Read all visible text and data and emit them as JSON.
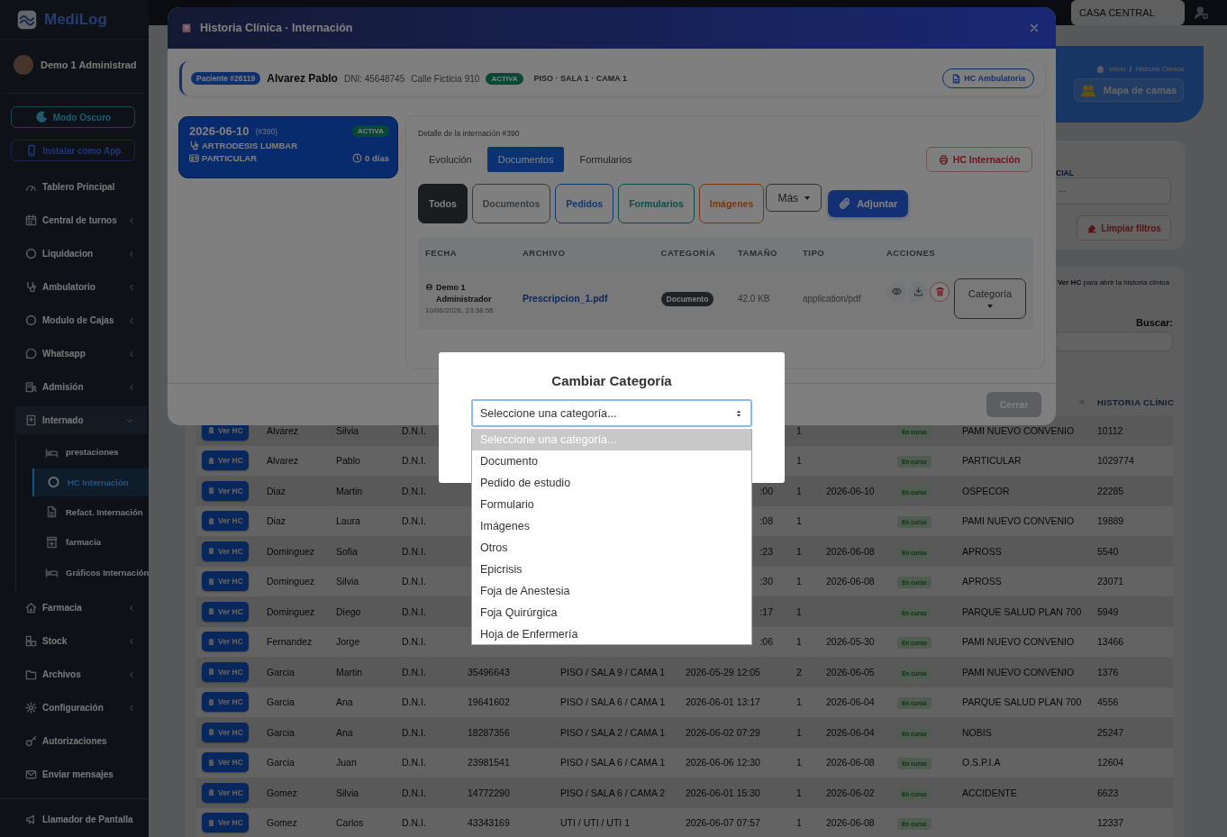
{
  "sidebar": {
    "logo": "MediLog",
    "user": "Demo 1 Administrad",
    "buttons": [
      {
        "label": "Modo Oscuro",
        "kind": "theme"
      },
      {
        "label": "Instalar como App",
        "kind": "install"
      }
    ],
    "items": [
      {
        "label": "Tablero Principal",
        "kind": "link",
        "selected": false
      },
      {
        "label": "Central de turnos",
        "kind": "menu",
        "expanded": false,
        "selected": false
      },
      {
        "label": "Liquidacion",
        "kind": "menu",
        "expanded": false,
        "selected": false
      },
      {
        "label": "Ambulatorio",
        "kind": "menu",
        "expanded": false,
        "selected": false
      },
      {
        "label": "Modulo de Cajas",
        "kind": "menu",
        "expanded": false,
        "selected": false
      },
      {
        "label": "Whatsapp",
        "kind": "menu",
        "expanded": false,
        "selected": false
      },
      {
        "label": "Admisión",
        "kind": "menu",
        "expanded": false,
        "selected": false
      },
      {
        "label": "Internado",
        "kind": "menu",
        "expanded": true,
        "selected": false,
        "children": [
          {
            "label": "prestaciones",
            "selected": false
          },
          {
            "label": "HC Internación",
            "selected": true
          },
          {
            "label": "Refact. Internación",
            "selected": false
          },
          {
            "label": "farmacia",
            "selected": false
          },
          {
            "label": "Gráficos Internación",
            "selected": false
          }
        ]
      },
      {
        "label": "Farmacia",
        "kind": "menu",
        "expanded": false,
        "selected": false
      },
      {
        "label": "Stock",
        "kind": "menu",
        "expanded": false,
        "selected": false
      },
      {
        "label": "Archivos",
        "kind": "menu",
        "expanded": false,
        "selected": false
      },
      {
        "label": "Configuración",
        "kind": "menu",
        "expanded": false,
        "selected": false
      },
      {
        "label": "Autorizaciones",
        "kind": "link",
        "selected": false
      },
      {
        "label": "Enviar mensajes",
        "kind": "link",
        "selected": false
      }
    ],
    "footer_item": "Llamador de Pantalla"
  },
  "topbar": {
    "branch": "CASA CENTRAL"
  },
  "page": {
    "breadcrumb": {
      "items": [
        "Inicio",
        "Historia Clínica"
      ],
      "separator": "/"
    },
    "map_button": "Mapa de camas",
    "filter_label": "CIAL",
    "filter_value": "...",
    "clear_button": "Limpiar filtros",
    "hint": "**Ver HC** para abrir la historia clínica",
    "search_label": "Buscar:",
    "table": {
      "last_column": "HISTORIA CLÍNIC",
      "rows": [
        {
          "button": "Ver HC",
          "surname": "Alvarez",
          "name": "Silvia",
          "doc_type": "D.N.I.",
          "count": "1",
          "status": "En curso",
          "insurer": "PAMI NUEVO CONVENIO",
          "record": "10112"
        },
        {
          "button": "Ver HC",
          "surname": "Alvarez",
          "name": "Pablo",
          "doc_type": "D.N.I.",
          "count": "1",
          "status": "En curso",
          "insurer": "PARTICULAR",
          "record": "1029774"
        },
        {
          "button": "Ver HC",
          "surname": "Diaz",
          "name": "Martin",
          "doc_type": "D.N.I.",
          "admitted_tail": ":00",
          "count": "1",
          "date": "2026-06-10",
          "status": "En curso",
          "insurer": "OSPECOR",
          "record": "22285"
        },
        {
          "button": "Ver HC",
          "surname": "Diaz",
          "name": "Laura",
          "doc_type": "D.N.I.",
          "admitted_tail": ":08",
          "count": "1",
          "status": "En curso",
          "insurer": "PAMI NUEVO CONVENIO",
          "record": "19889"
        },
        {
          "button": "Ver HC",
          "surname": "Dominguez",
          "name": "Sofia",
          "doc_type": "D.N.I.",
          "admitted_tail": ":23",
          "count": "1",
          "date": "2026-06-08",
          "status": "En curso",
          "insurer": "APROSS",
          "record": "5540"
        },
        {
          "button": "Ver HC",
          "surname": "Dominguez",
          "name": "Silvia",
          "doc_type": "D.N.I.",
          "admitted_tail": ":30",
          "count": "1",
          "date": "2026-06-08",
          "status": "En curso",
          "insurer": "APROSS",
          "record": "23071"
        },
        {
          "button": "Ver HC",
          "surname": "Dominguez",
          "name": "Diego",
          "doc_type": "D.N.I.",
          "admitted_tail": ":17",
          "count": "1",
          "status": "En curso",
          "insurer": "PARQUE SALUD PLAN 700",
          "record": "5949"
        },
        {
          "button": "Ver HC",
          "surname": "Fernandez",
          "name": "Jorge",
          "doc_type": "D.N.I.",
          "admitted_tail": ":06",
          "count": "1",
          "date": "2026-05-30",
          "status": "En curso",
          "insurer": "PAMI NUEVO CONVENIO",
          "record": "13466"
        },
        {
          "button": "Ver HC",
          "surname": "Garcia",
          "name": "Martin",
          "doc_type": "D.N.I.",
          "doc_number": "35496643",
          "location": "PISO / SALA 9 / CAMA 1",
          "admitted": "2026-05-29 12:05",
          "count": "2",
          "date": "2026-06-05",
          "status": "En curso",
          "insurer": "PAMI NUEVO CONVENIO",
          "record": "1376"
        },
        {
          "button": "Ver HC",
          "surname": "Garcia",
          "name": "Ana",
          "doc_type": "D.N.I.",
          "doc_number": "19641602",
          "location": "PISO / SALA 6 / CAMA 1",
          "admitted": "2026-06-01 13:17",
          "count": "1",
          "date": "2026-06-04",
          "status": "En curso",
          "insurer": "PARQUE SALUD PLAN 700",
          "record": "4556"
        },
        {
          "button": "Ver HC",
          "surname": "Garcia",
          "name": "Ana",
          "doc_type": "D.N.I.",
          "doc_number": "18287356",
          "location": "PISO / SALA 2 / CAMA 1",
          "admitted": "2026-06-02 07:29",
          "count": "1",
          "date": "2026-06-04",
          "status": "En curso",
          "insurer": "NOBIS",
          "record": "25247"
        },
        {
          "button": "Ver HC",
          "surname": "Garcia",
          "name": "Juan",
          "doc_type": "D.N.I.",
          "doc_number": "23981541",
          "location": "PISO / SALA 6 / CAMA 1",
          "admitted": "2026-06-06 12:30",
          "count": "1",
          "date": "2026-06-08",
          "status": "En curso",
          "insurer": "O.S.P.I.A",
          "record": "12604"
        },
        {
          "button": "Ver HC",
          "surname": "Gomez",
          "name": "Silvia",
          "doc_type": "D.N.I.",
          "doc_number": "14772290",
          "location": "PISO / SALA 6 / CAMA 2",
          "admitted": "2026-06-01 15:30",
          "count": "1",
          "date": "2026-06-02",
          "status": "En curso",
          "insurer": "ACCIDENTE",
          "record": "6623"
        },
        {
          "button": "Ver HC",
          "surname": "Gomez",
          "name": "Carlos",
          "doc_type": "D.N.I.",
          "doc_number": "43343169",
          "location": "UTI / UTI / UTI 1",
          "admitted": "2026-06-07 07:57",
          "count": "1",
          "date": "2026-06-08",
          "status": "En curso",
          "record": "12337"
        }
      ]
    }
  },
  "record_modal": {
    "title": "Historia Clínica · Internación",
    "patient": {
      "badge": "Paciente #26119",
      "name": "Alvarez Pablo",
      "dni": "DNI: 45648745",
      "address": "Calle Ficticia 910",
      "status": "ACTIVA",
      "location": "PISO · SALA 1 · CAMA 1",
      "button": "HC Ambulatoria"
    },
    "admissions": [
      {
        "date": "2026-06-10",
        "number": "(#390)",
        "status": "ACTIVA",
        "diagnosis": "ARTRODESIS LUMBAR",
        "coverage": "PARTICULAR",
        "duration": "0 días",
        "selected": true
      }
    ],
    "detail": {
      "title": "Detalle de la internación #390",
      "tabs": [
        {
          "label": "Evolución",
          "selected": false
        },
        {
          "label": "Documentos",
          "selected": true
        },
        {
          "label": "Formularios",
          "selected": false
        }
      ],
      "print_button": "HC Internación",
      "filters": [
        {
          "label": "Todos",
          "selected": true,
          "kind": "all"
        },
        {
          "label": "Documentos",
          "selected": false,
          "kind": "documents"
        },
        {
          "label": "Pedidos",
          "selected": false,
          "kind": "orders"
        },
        {
          "label": "Formularios",
          "selected": false,
          "kind": "forms"
        },
        {
          "label": "Imágenes",
          "selected": false,
          "kind": "images"
        }
      ],
      "more_button": "Más",
      "attach_button": "Adjuntar",
      "columns": [
        "FECHA",
        "ARCHIVO",
        "CATEGORÍA",
        "TAMAÑO",
        "TIPO",
        "ACCIONES"
      ],
      "rows": [
        {
          "author": "Demo 1 Administrador",
          "timestamp": "10/06/2026, 23:38:56",
          "file": "Prescripcion_1.pdf",
          "category": "Documento",
          "size": "42.0 KB",
          "type": "application/pdf",
          "category_button": "Categoría"
        }
      ]
    },
    "close_button": "Cerrar"
  },
  "category_modal": {
    "title": "Cambiar Categoría",
    "select": {
      "value": "Seleccione una categoría...",
      "open": true,
      "options": [
        {
          "label": "Seleccione una categoría...",
          "selected": true
        },
        {
          "label": "Documento",
          "selected": false
        },
        {
          "label": "Pedido de estudio",
          "selected": false
        },
        {
          "label": "Formulario",
          "selected": false
        },
        {
          "label": "Imágenes",
          "selected": false
        },
        {
          "label": "Otros",
          "selected": false
        },
        {
          "label": "Epicrisis",
          "selected": false
        },
        {
          "label": "Foja de Anestesia",
          "selected": false
        },
        {
          "label": "Foja Quirúrgica",
          "selected": false
        },
        {
          "label": "Hoja de Enfermería",
          "selected": false
        }
      ]
    }
  }
}
